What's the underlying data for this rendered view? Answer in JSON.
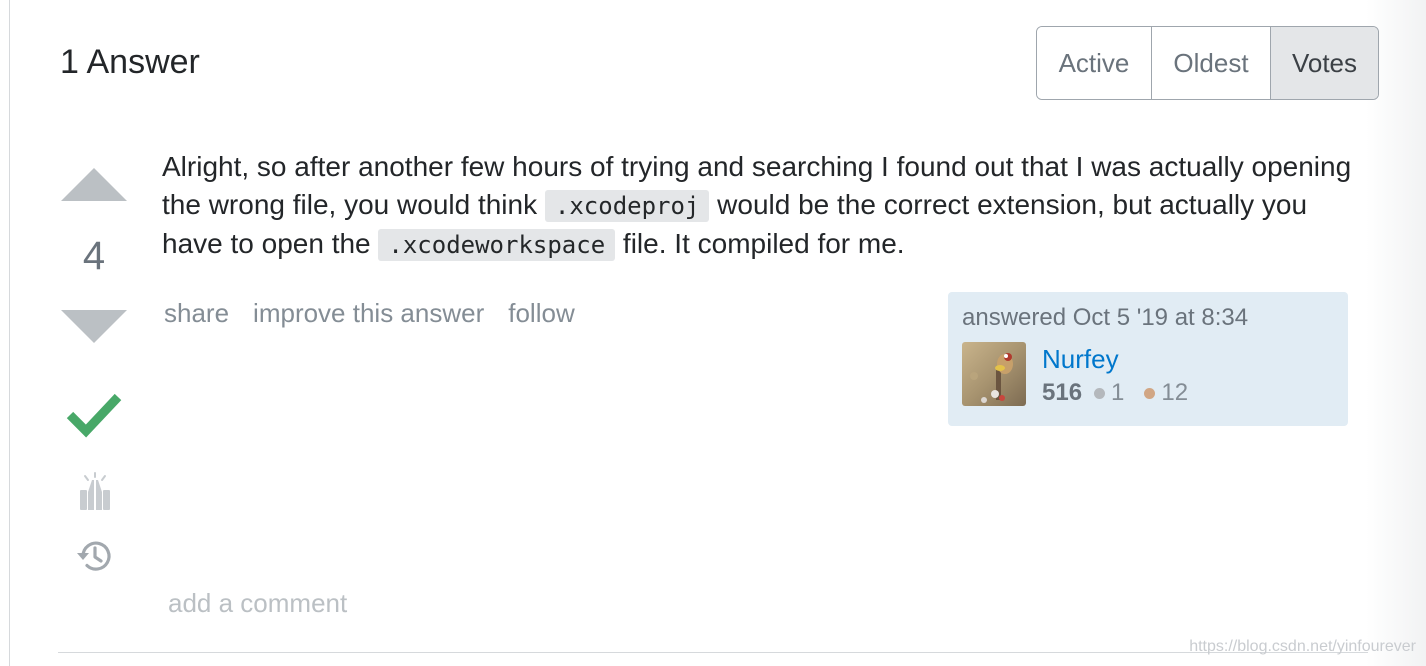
{
  "answers_header": {
    "title": "1 Answer"
  },
  "sort_tabs": [
    {
      "label": "Active",
      "selected": false
    },
    {
      "label": "Oldest",
      "selected": false
    },
    {
      "label": "Votes",
      "selected": true
    }
  ],
  "answer": {
    "vote_count": "4",
    "accepted": true,
    "body": {
      "part1": "Alright, so after another few hours of trying and searching I found out that I was actually opening the wrong file, you would think ",
      "code1": ".xcodeproj",
      "part2": " would be the correct extension, but actually you have to open the ",
      "code2": ".xcodeworkspace",
      "part3": " file. It compiled for me."
    },
    "menu": {
      "share": "share",
      "improve": "improve this answer",
      "follow": "follow"
    },
    "user_card": {
      "action_time": "answered Oct 5 '19 at 8:34",
      "user_name": "Nurfey",
      "reputation": "516",
      "silver_badges": "1",
      "bronze_badges": "12"
    },
    "add_comment": "add a comment"
  },
  "watermark": "https://blog.csdn.net/yinfourever",
  "colors": {
    "link_blue": "#0077cc",
    "accepted_green": "#48a868",
    "user_card_bg": "#e1ecf4",
    "vote_arrow_gray": "#bbc0c4",
    "silver_badge": "#b4b8bc",
    "bronze_badge": "#d1a684"
  },
  "icons": {
    "accepted": "check-icon",
    "bounty": "bounty-award-icon",
    "history": "history-icon"
  }
}
